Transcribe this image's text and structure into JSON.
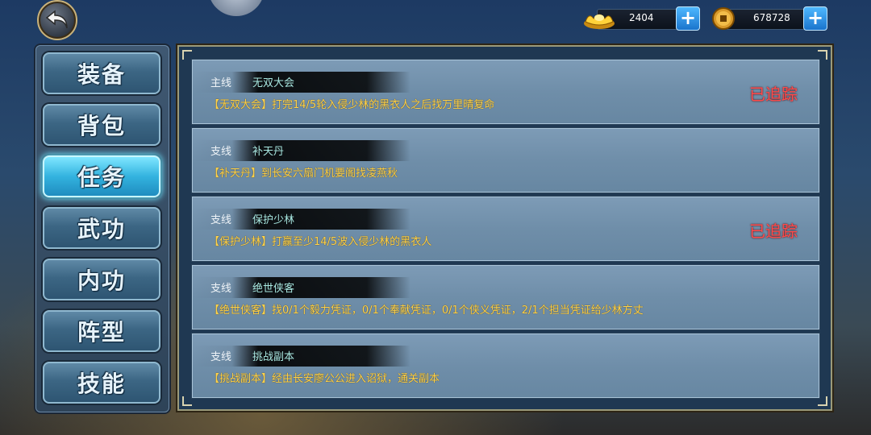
{
  "currency": {
    "gold_ingot": "2404",
    "copper_coin": "678728",
    "plus_label": "+"
  },
  "sidebar": {
    "items": [
      {
        "label": "装备",
        "active": false
      },
      {
        "label": "背包",
        "active": false
      },
      {
        "label": "任务",
        "active": true
      },
      {
        "label": "武功",
        "active": false
      },
      {
        "label": "内功",
        "active": false
      },
      {
        "label": "阵型",
        "active": false
      },
      {
        "label": "技能",
        "active": false
      }
    ]
  },
  "quests": [
    {
      "type": "主线",
      "name": "无双大会",
      "desc": "【无双大会】打完14/5轮入侵少林的黑衣人之后找万里晴复命",
      "status": "已追踪"
    },
    {
      "type": "支线",
      "name": "补天丹",
      "desc": "【补天丹】到长安六扇门机要阁找凌燕秋",
      "status": ""
    },
    {
      "type": "支线",
      "name": "保护少林",
      "desc": "【保护少林】打赢至少14/5波入侵少林的黑衣人",
      "status": "已追踪"
    },
    {
      "type": "支线",
      "name": "绝世侠客",
      "desc": "【绝世侠客】找0/1个毅力凭证，0/1个奉献凭证，0/1个侠义凭证，2/1个担当凭证给少林方丈",
      "status": ""
    },
    {
      "type": "支线",
      "name": "挑战副本",
      "desc": "【挑战副本】经由长安廖公公进入诏狱，通关副本",
      "status": ""
    }
  ],
  "colors": {
    "tracked": "#ff4a4a",
    "quest_desc": "#ffd24a",
    "active_tab": "#33b3df"
  }
}
